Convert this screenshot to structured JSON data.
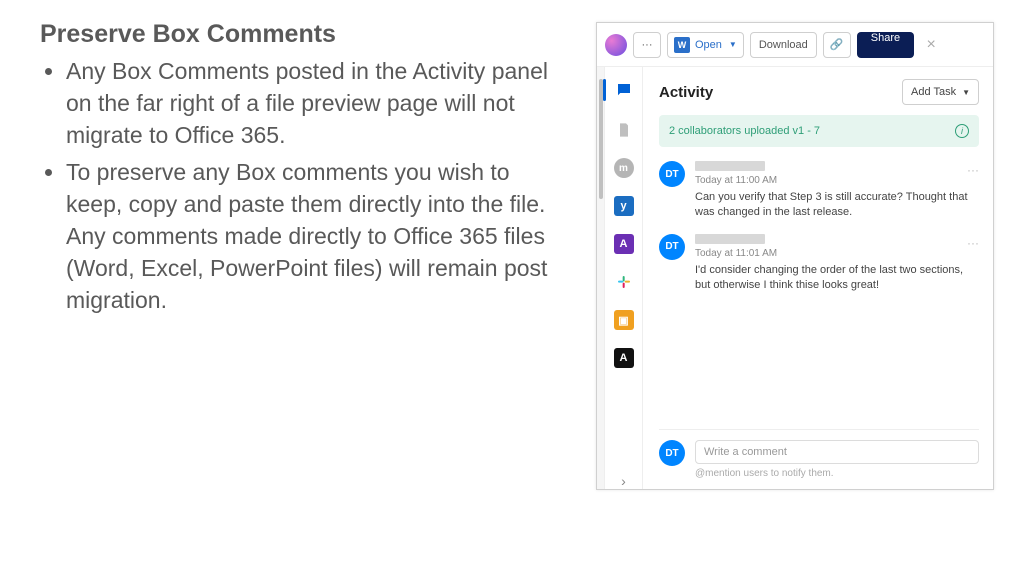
{
  "slide": {
    "title": "Preserve Box Comments",
    "bullets": [
      "Any Box Comments posted in the Activity panel on the far right of a file preview page will not migrate to Office 365.",
      "To preserve any Box comments you wish to keep, copy and paste them directly into the file. Any comments made directly to Office 365 files (Word, Excel, PowerPoint files) will remain post migration."
    ]
  },
  "toolbar": {
    "open_label": "Open",
    "download_label": "Download",
    "share_label": "Share",
    "more_label": "···",
    "word_glyph": "W",
    "link_glyph": "🔗",
    "close_glyph": "×"
  },
  "rail": {
    "m": "m",
    "y": "y",
    "pdf": "A",
    "lock": "▣",
    "pdf2": "A",
    "chev": "›"
  },
  "panel": {
    "title": "Activity",
    "add_task": "Add Task",
    "banner": "2 collaborators uploaded v1 - 7",
    "info_glyph": "i"
  },
  "comments": [
    {
      "initials": "DT",
      "time": "Today at 11:00 AM",
      "text": "Can you verify that Step 3 is still accurate? Thought that was changed in the last release."
    },
    {
      "initials": "DT",
      "time": "Today at 11:01 AM",
      "text": "I'd consider changing the order of the last two sections, but otherwise I think thise looks great!"
    }
  ],
  "compose": {
    "placeholder": "Write a comment",
    "hint": "@mention users to notify them.",
    "initials": "DT"
  }
}
